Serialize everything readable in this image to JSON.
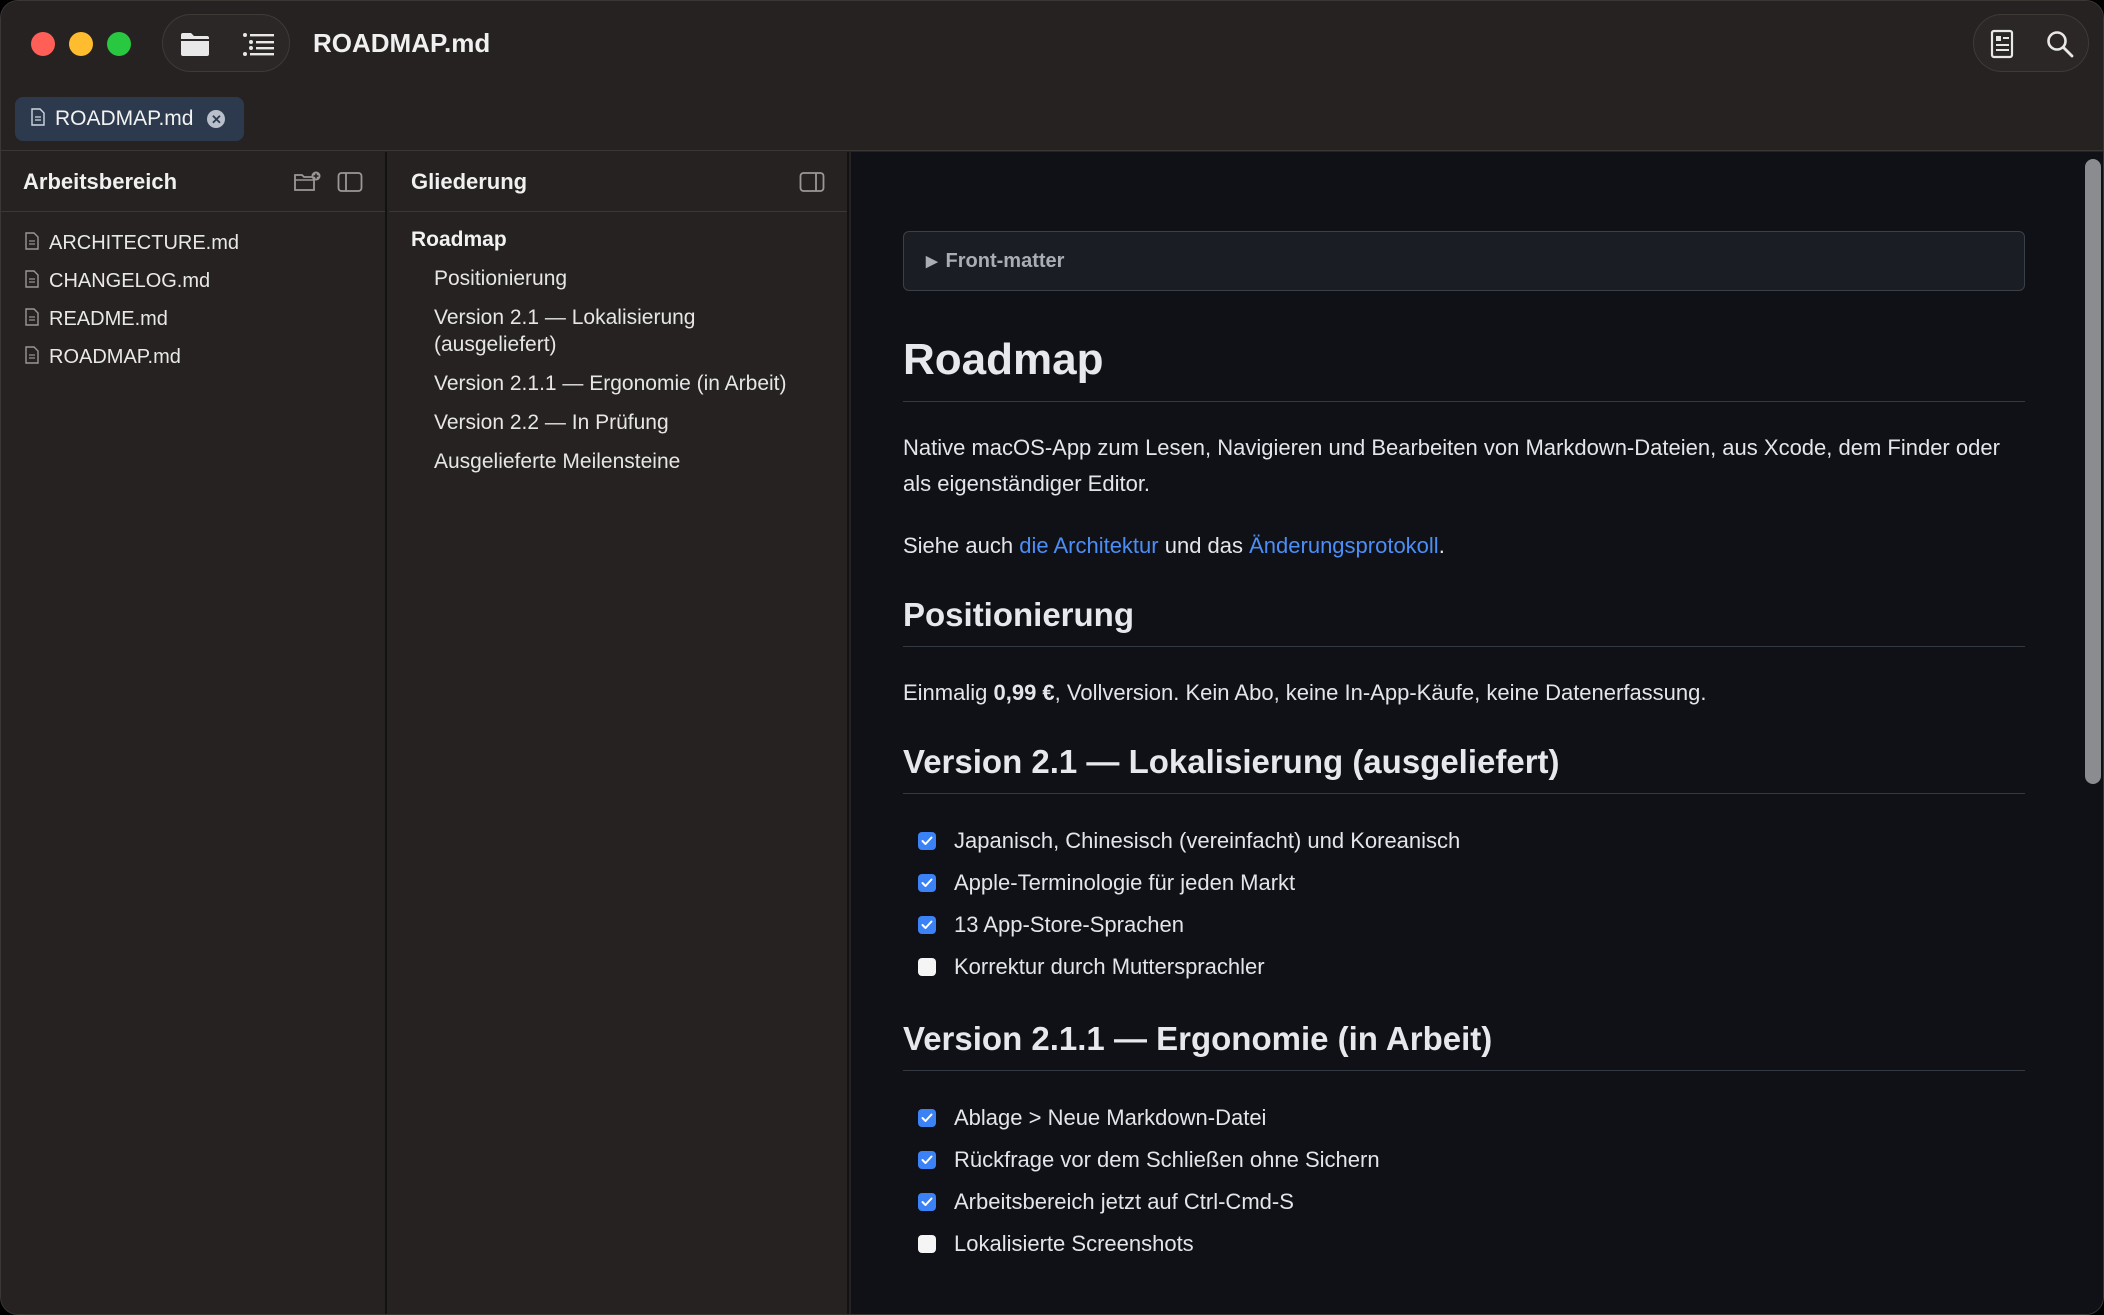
{
  "window": {
    "title": "ROADMAP.md"
  },
  "toolbar": {
    "left_icons": [
      "folder-icon",
      "outline-list-icon"
    ],
    "right_icons": [
      "reader-mode-icon",
      "search-icon"
    ]
  },
  "tabs": [
    {
      "label": "ROADMAP.md",
      "active": true
    }
  ],
  "workspace": {
    "title": "Arbeitsbereich",
    "files": [
      {
        "label": "ARCHITECTURE.md"
      },
      {
        "label": "CHANGELOG.md"
      },
      {
        "label": "README.md"
      },
      {
        "label": "ROADMAP.md"
      }
    ]
  },
  "outline": {
    "title": "Gliederung",
    "items": [
      {
        "label": "Roadmap",
        "level": 1
      },
      {
        "label": "Positionierung",
        "level": 2
      },
      {
        "label": "Version 2.1 — Lokalisierung (ausgeliefert)",
        "level": 2
      },
      {
        "label": "Version 2.1.1 — Ergonomie (in Arbeit)",
        "level": 2
      },
      {
        "label": "Version 2.2 — In Prüfung",
        "level": 2
      },
      {
        "label": "Ausgelieferte Meilensteine",
        "level": 2
      }
    ]
  },
  "document": {
    "frontmatter_label": "Front-matter",
    "h1": "Roadmap",
    "intro": "Native macOS-App zum Lesen, Navigieren und Bearbeiten von Markdown-Dateien, aus Xcode, dem Finder oder als eigenständiger Editor.",
    "see_also": {
      "prefix": "Siehe auch ",
      "link1": "die Architektur",
      "middle": " und das ",
      "link2": "Änderungsprotokoll",
      "suffix": "."
    },
    "section_positioning": {
      "heading": "Positionierung",
      "prefix": "Einmalig ",
      "price": "0,99 €",
      "suffix": ", Vollversion. Kein Abo, keine In-App-Käufe, keine Datenerfassung."
    },
    "section_v21": {
      "heading": "Version 2.1 — Lokalisierung (ausgeliefert)",
      "tasks": [
        {
          "label": "Japanisch, Chinesisch (vereinfacht) und Koreanisch",
          "done": true
        },
        {
          "label": "Apple-Terminologie für jeden Markt",
          "done": true
        },
        {
          "label": "13 App-Store-Sprachen",
          "done": true
        },
        {
          "label": "Korrektur durch Muttersprachler",
          "done": false
        }
      ]
    },
    "section_v211": {
      "heading": "Version 2.1.1 — Ergonomie (in Arbeit)",
      "tasks": [
        {
          "label": "Ablage > Neue Markdown-Datei",
          "done": true
        },
        {
          "label": "Rückfrage vor dem Schließen ohne Sichern",
          "done": true
        },
        {
          "label": "Arbeitsbereich jetzt auf Ctrl-Cmd-S",
          "done": true
        },
        {
          "label": "Lokalisierte Screenshots",
          "done": false
        }
      ]
    }
  },
  "colors": {
    "accent": "#3b82f6",
    "link": "#4c8ef7",
    "tab_active": "#2d3a4e"
  }
}
